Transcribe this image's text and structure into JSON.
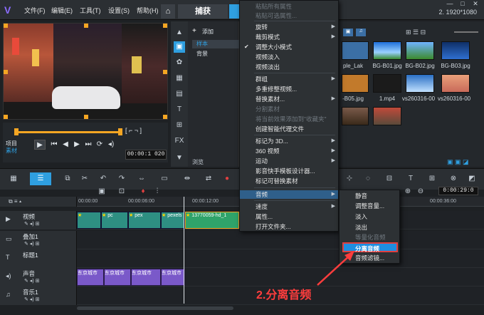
{
  "menubar": {
    "items": [
      "文件(F)",
      "编辑(E)",
      "工具(T)",
      "设置(S)",
      "帮助(H)"
    ]
  },
  "tabs": {
    "capture": "捕获",
    "edit": "编"
  },
  "resolution": "2. 1920*1080",
  "player": {
    "project_label": "项目",
    "clip_label": "素材",
    "timecode": "00:00:1 020",
    "crop_icons": "[ ⌐ ¬ ]"
  },
  "library": {
    "add_label": "添加",
    "folders": [
      "样本",
      "背景"
    ],
    "browse_label": "浏览",
    "thumbnails": [
      {
        "caption": "ple_Lak",
        "color": "#3b6fa5"
      },
      {
        "caption": "BG-B01.jpg",
        "color": "#1f66c8"
      },
      {
        "caption": "BG-B02.jpg",
        "color": "#3c8a2d"
      },
      {
        "caption": "BG-B03.jpg",
        "color": "#1a3f7a"
      },
      {
        "caption": "-B05.jpg",
        "color": "#c27a2b"
      },
      {
        "caption": "1.mp4",
        "color": "#1b1b1b"
      },
      {
        "caption": "vs260316-00",
        "color": "#2a6fc4"
      },
      {
        "caption": "vs260316-00",
        "color": "#c96a5a"
      },
      {
        "caption": "",
        "color": "#5a4a3a"
      }
    ]
  },
  "context_menu": {
    "items": [
      {
        "label": "粘贴所有属性",
        "disabled": true
      },
      {
        "label": "粘贴可选属性...",
        "disabled": true
      },
      {
        "label": "旋转",
        "arrow": true
      },
      {
        "label": "裁剪模式",
        "arrow": true
      },
      {
        "label": "调整大小模式",
        "checked": true
      },
      {
        "label": "视频淡入"
      },
      {
        "label": "视频淡出"
      },
      {
        "label": "群组",
        "arrow": true
      },
      {
        "label": "多重修整视频..."
      },
      {
        "label": "替换素材...",
        "arrow": true
      },
      {
        "label": "分割素材",
        "disabled": true
      },
      {
        "label": "将当前效果添加到\"收藏夹\"",
        "disabled": true
      },
      {
        "label": "创建智能代理文件"
      },
      {
        "label": "标记为 3D...",
        "arrow": true
      },
      {
        "label": "360 视频",
        "arrow": true
      },
      {
        "label": "运动",
        "arrow": true
      },
      {
        "label": "影音快手模板设计器..."
      },
      {
        "label": "标记可替换素材"
      },
      {
        "label": "音频",
        "arrow": true,
        "highlighted": true
      },
      {
        "label": "速度",
        "arrow": true
      },
      {
        "label": "属性..."
      },
      {
        "label": "打开文件夹..."
      }
    ]
  },
  "audio_submenu": {
    "items": [
      {
        "label": "静音"
      },
      {
        "label": "调整音量..."
      },
      {
        "label": "淡入"
      },
      {
        "label": "淡出"
      },
      {
        "label": "等量化音频",
        "disabled": true
      },
      {
        "label": "分离音频",
        "selected": true
      },
      {
        "label": "音频滤镜..."
      }
    ]
  },
  "timeline": {
    "ruler": [
      "00:00:00",
      "00:00:06:00",
      "00:00:12:00",
      "00:00:36:00"
    ],
    "timecode": "0:00:29:0",
    "tracks": [
      {
        "name": "视频"
      },
      {
        "name": "叠加1"
      },
      {
        "name": "标题1"
      },
      {
        "name": "声音"
      },
      {
        "name": "音乐1"
      }
    ],
    "video_clips": [
      "pc",
      "pex",
      "pexels",
      "13770059-hd_1"
    ],
    "audio_clip_label": "东京城市"
  },
  "annotation": "2.分离音频"
}
